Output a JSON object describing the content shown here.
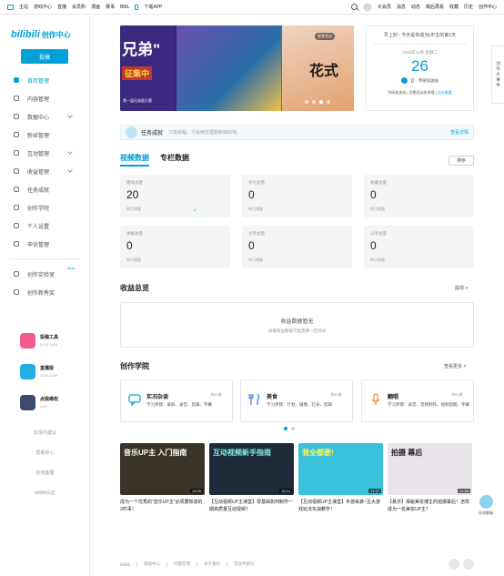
{
  "topnav": {
    "left_items": [
      "主站",
      "游戏中心",
      "直播",
      "会员购",
      "漫画",
      "赛事",
      "BML",
      "下载APP"
    ],
    "right_items": [
      "大会员",
      "消息",
      "动态",
      "稿后再看",
      "收藏",
      "历史",
      "创作中心"
    ]
  },
  "sidebar": {
    "logo": "bilibili",
    "logo_sub": "创作中心",
    "upload_label": "投稿",
    "nav": [
      {
        "label": "首页管理",
        "active": true
      },
      {
        "label": "内容管理"
      },
      {
        "label": "数据中心",
        "expand": true
      },
      {
        "label": "粉丝管理"
      },
      {
        "label": "互动管理",
        "expand": true
      },
      {
        "label": "收益管理",
        "expand": true
      },
      {
        "label": "任务成就"
      },
      {
        "label": "创作学院"
      },
      {
        "label": "个人设置"
      },
      {
        "label": "申诉管理"
      }
    ],
    "extra_nav": [
      {
        "label": "创作实验室",
        "badge": "Beta"
      },
      {
        "label": "创作新秀奖"
      }
    ],
    "apps": [
      {
        "name": "投稿工具",
        "version": "2.0.0.1054",
        "color": "#f25d8e"
      },
      {
        "name": "直播姬",
        "version": "2.0.0.2149",
        "color": "#23ade5"
      },
      {
        "name": "点我维权",
        "version": "v1.0",
        "color": "#3b4b6b"
      }
    ],
    "footer_links": [
      "反馈与建议",
      "帮助中心",
      "在线客服",
      "bilibili认证"
    ]
  },
  "banner": {
    "text1": "兄弟\"",
    "text2": "征集中",
    "text3": "第一届兄弟剧大赛",
    "text4": "花式",
    "more": "更多活动"
  },
  "datecard": {
    "greeting": "早上好~ 今天是你成为UP主的第1天",
    "date": "2019年11月 星期二",
    "day": "26",
    "lunar": "宜 · 专研加油站",
    "tip_prefix": "专研加油站 | 近期活动多多哦 |",
    "tip_link": "点击查看"
  },
  "sidetab": {
    "chars": [
      "创",
      "作",
      "大",
      "事",
      "件"
    ]
  },
  "achievement": {
    "title": "任务成就",
    "desc": "只有启程，才会到达理想和目的地。",
    "link": "查看详情"
  },
  "tabs": [
    "视频数据",
    "专栏数据"
  ],
  "sort_label": "排序",
  "stats": [
    {
      "label": "播放总量",
      "value": "20",
      "yesterday": "昨日增量",
      "delta": "4"
    },
    {
      "label": "评论总量",
      "value": "0",
      "yesterday": "昨日增量",
      "delta": "-"
    },
    {
      "label": "收藏总量",
      "value": "0",
      "yesterday": "昨日增量",
      "delta": "-"
    },
    {
      "label": "弹幕总量",
      "value": "0",
      "yesterday": "昨日增量",
      "delta": "-"
    },
    {
      "label": "点赞总量",
      "value": "0",
      "yesterday": "昨日增量",
      "delta": "-"
    },
    {
      "label": "分享总量",
      "value": "0",
      "yesterday": "昨日增量",
      "delta": "-"
    }
  ],
  "income": {
    "title": "收益总览",
    "more": "提现 >",
    "empty": "收益数据暂无",
    "hint": "加载收益数据可能需要一定时间"
  },
  "academy": {
    "title": "创作学院",
    "more": "查看更多 >",
    "courses": [
      {
        "title": "实况杂谈",
        "count": "共63课",
        "steps": "学习步骤：录屏、录音、剪辑、字幕",
        "color": "#00a1d6"
      },
      {
        "title": "美食",
        "count": "共58课",
        "steps": "学习步骤：计划、摄像、灯光、剪辑",
        "color": "#3b7fd8"
      },
      {
        "title": "翻唱",
        "count": "共65课",
        "steps": "学习步骤：录音、音频制作、视频后期、字幕",
        "color": "#f5883d"
      }
    ]
  },
  "videos": [
    {
      "title": "成为一个优秀的\"音乐UP主\"必须要知道的3件事！",
      "thumb_text": "音乐UP主 入门指南",
      "duration": "12:09",
      "bg": "#3a3328",
      "fg": "#ffffff"
    },
    {
      "title": "【互动视频UP主课堂】零基础如何制作一期高质量互动视频？",
      "thumb_text": "互动视频新手指南",
      "duration": "10:14",
      "bg": "#1f2a3a",
      "fg": "#7df2e0"
    },
    {
      "title": "【互动视频UP主课堂】手游来袭~互大游戏玩法实战教学！",
      "thumb_text": "我全都要!",
      "duration": "11:27",
      "bg": "#39c1d9",
      "fg": "#fdf45a"
    },
    {
      "title": "【悬济】揭秘美妆博主的拍摄幕后！怎样成为一名美妆UP主？",
      "thumb_text": "拍摄 幕后",
      "duration": "11:58",
      "bg": "#e9e5ea",
      "fg": "#222222"
    }
  ],
  "float_service": "在线客服",
  "footer": [
    "bilibili",
    "帮助中心",
    "问题反馈",
    "关于我们",
    "活动专题页"
  ]
}
